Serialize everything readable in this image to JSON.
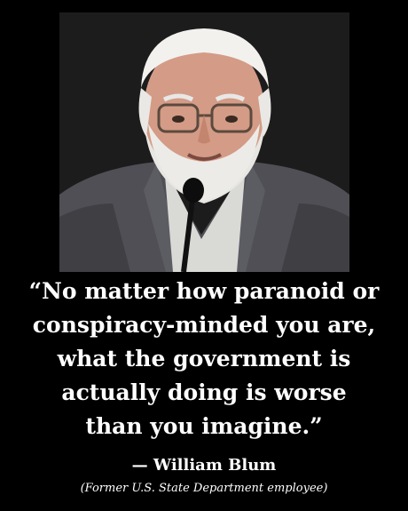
{
  "quote": {
    "lines": [
      "“No matter how paranoid or",
      "conspiracy-minded you are,",
      "what the government is",
      "actually doing is worse",
      "than you imagine.”"
    ]
  },
  "attribution": {
    "author": "— William Blum",
    "role": "(Former U.S. State Department employee)"
  },
  "colors": {
    "background": "#000000",
    "text": "#ffffff"
  }
}
